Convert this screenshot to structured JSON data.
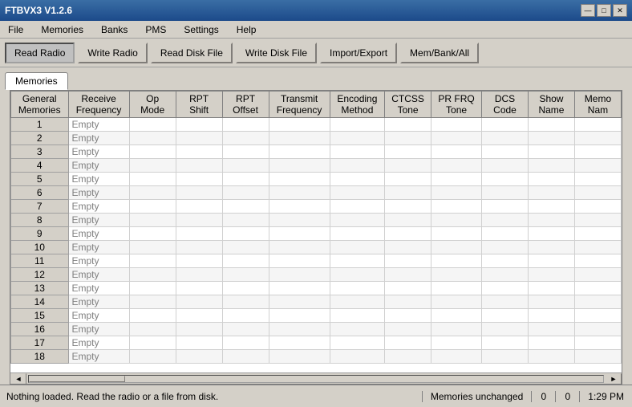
{
  "window": {
    "title": "FTBVX3 V1.2.6"
  },
  "menu": {
    "items": [
      "File",
      "Memories",
      "Banks",
      "PMS",
      "Settings",
      "Help"
    ]
  },
  "toolbar": {
    "buttons": [
      {
        "label": "Read Radio",
        "active": true
      },
      {
        "label": "Write Radio",
        "active": false
      },
      {
        "label": "Read Disk File",
        "active": false
      },
      {
        "label": "Write Disk File",
        "active": false
      },
      {
        "label": "Import/Export",
        "active": false
      },
      {
        "label": "Mem/Bank/All",
        "active": false
      }
    ]
  },
  "tabs": [
    {
      "label": "Memories",
      "active": true
    }
  ],
  "table": {
    "columns": [
      "General\nMemories",
      "Receive\nFrequency",
      "Op\nMode",
      "RPT\nShift",
      "RPT\nOffset",
      "Transmit\nFrequency",
      "Encoding\nMethod",
      "CTCSS\nTone",
      "PR FRQ\nTone",
      "DCS\nCode",
      "Show\nName",
      "Memo\nNam"
    ],
    "rows": [
      {
        "num": 1,
        "freq": "Empty"
      },
      {
        "num": 2,
        "freq": "Empty"
      },
      {
        "num": 3,
        "freq": "Empty"
      },
      {
        "num": 4,
        "freq": "Empty"
      },
      {
        "num": 5,
        "freq": "Empty"
      },
      {
        "num": 6,
        "freq": "Empty"
      },
      {
        "num": 7,
        "freq": "Empty"
      },
      {
        "num": 8,
        "freq": "Empty"
      },
      {
        "num": 9,
        "freq": "Empty"
      },
      {
        "num": 10,
        "freq": "Empty"
      },
      {
        "num": 11,
        "freq": "Empty"
      },
      {
        "num": 12,
        "freq": "Empty"
      },
      {
        "num": 13,
        "freq": "Empty"
      },
      {
        "num": 14,
        "freq": "Empty"
      },
      {
        "num": 15,
        "freq": "Empty"
      },
      {
        "num": 16,
        "freq": "Empty"
      },
      {
        "num": 17,
        "freq": "Empty"
      },
      {
        "num": 18,
        "freq": "Empty"
      }
    ]
  },
  "status": {
    "left": "Nothing loaded. Read the radio or a file from disk.",
    "memories": "Memories unchanged",
    "count1": "0",
    "count2": "0",
    "time": "1:29 PM"
  },
  "window_controls": {
    "minimize": "—",
    "maximize": "□",
    "close": "✕"
  }
}
